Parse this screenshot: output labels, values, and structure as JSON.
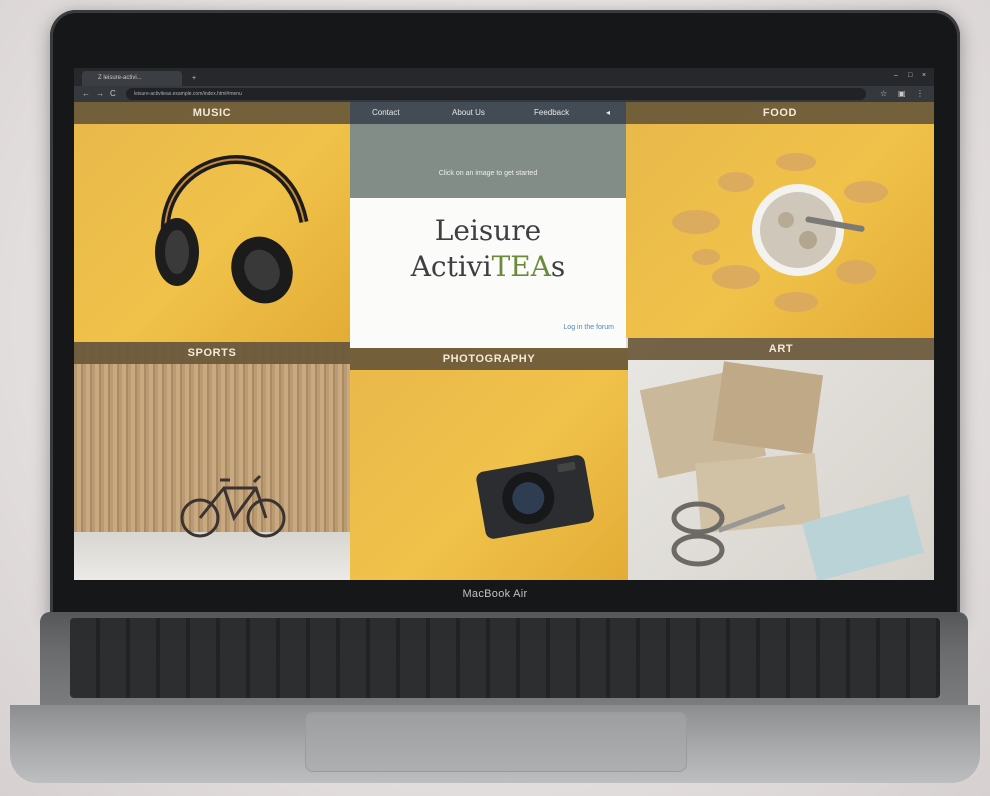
{
  "device": {
    "brand_label": "MacBook Air"
  },
  "browser": {
    "tab_title": "Z  leisure-activi...",
    "url": "leisure-activiteas.example.com/index.html#menu",
    "back_icon": "←",
    "reload_icon": "C",
    "new_tab_icon": "+"
  },
  "site": {
    "nav": {
      "contact": "Contact",
      "about": "About Us",
      "feedback": "Feedback"
    },
    "hint": "Click on an image to get started",
    "title_line1": "Leisure",
    "title_line2_prefix": "Activi",
    "title_line2_accent": "TEA",
    "title_line2_suffix": "s",
    "link": "Log in the forum",
    "tiles": {
      "music": "MUSIC",
      "food": "FOOD",
      "sports": "SPORTS",
      "photography": "PHOTOGRAPHY",
      "art": "ART"
    }
  },
  "colors": {
    "band": "#6a583a",
    "tea_accent": "#6b8a3c",
    "hero_grey": "#828d87",
    "tile_yellow": "#f0c24a"
  }
}
